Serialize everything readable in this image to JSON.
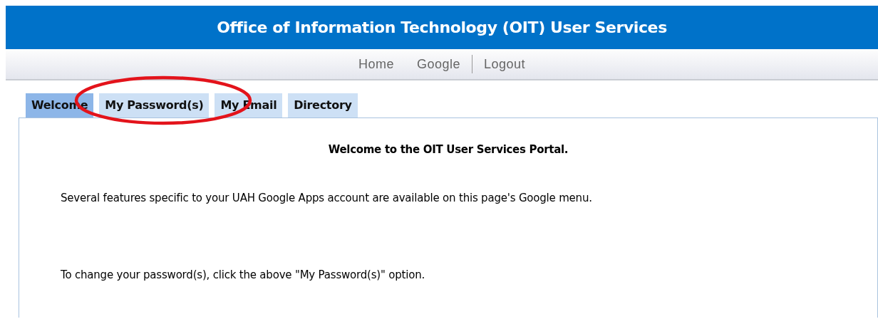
{
  "header": {
    "title": "Office of Information Technology (OIT) User Services"
  },
  "nav": [
    {
      "label": "Home",
      "divider_before": false
    },
    {
      "label": "Google",
      "divider_before": false
    },
    {
      "label": "Logout",
      "divider_before": true
    }
  ],
  "tabs": [
    {
      "label": "Welcome",
      "selected": true
    },
    {
      "label": "My Password(s)",
      "selected": false
    },
    {
      "label": "My Email",
      "selected": false
    },
    {
      "label": "Directory",
      "selected": false
    }
  ],
  "panel": {
    "heading": "Welcome to the OIT User Services Portal.",
    "paragraphs": [
      "Several features specific to your UAH Google Apps account are available on this page's Google menu.",
      "To change your password(s), click the above \"My Password(s)\" option."
    ]
  }
}
